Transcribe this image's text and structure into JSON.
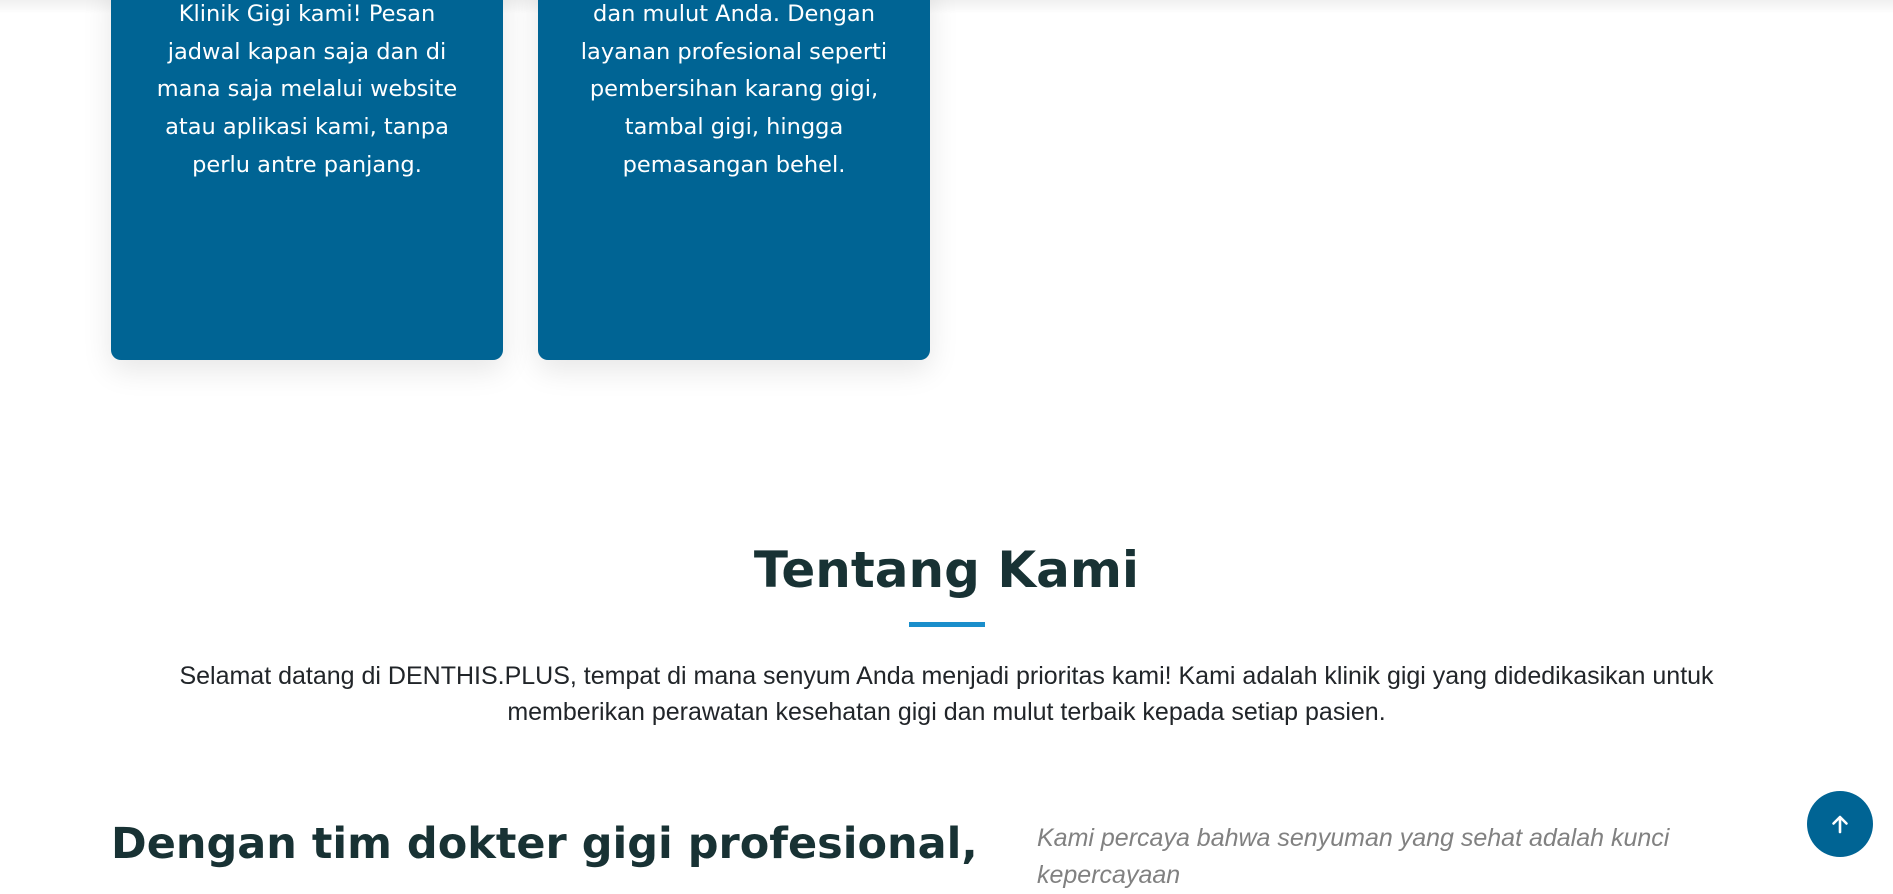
{
  "cards": [
    {
      "text": "Klinik Gigi kami! Pesan jadwal kapan saja dan di mana saja melalui website atau aplikasi kami, tanpa perlu antre panjang."
    },
    {
      "text": "dan mulut Anda. Dengan layanan profesional seperti pembersihan karang gigi, tambal gigi, hingga pemasangan behel."
    }
  ],
  "about": {
    "title": "Tentang Kami",
    "intro": "Selamat datang di DENTHIS.PLUS, tempat di mana senyum Anda menjadi prioritas kami! Kami adalah klinik gigi yang didedikasikan untuk memberikan perawatan kesehatan gigi dan mulut terbaik kepada setiap pasien.",
    "heading": "Dengan tim dokter gigi profesional,",
    "quote": "Kami percaya bahwa senyuman yang sehat adalah kunci kepercayaan"
  },
  "scroll_top": {
    "icon": "arrow-up-icon"
  },
  "colors": {
    "card_bg": "#006494",
    "accent": "#1a8ecb",
    "heading": "#183234",
    "body_text": "#212529",
    "muted_text": "#818181"
  }
}
